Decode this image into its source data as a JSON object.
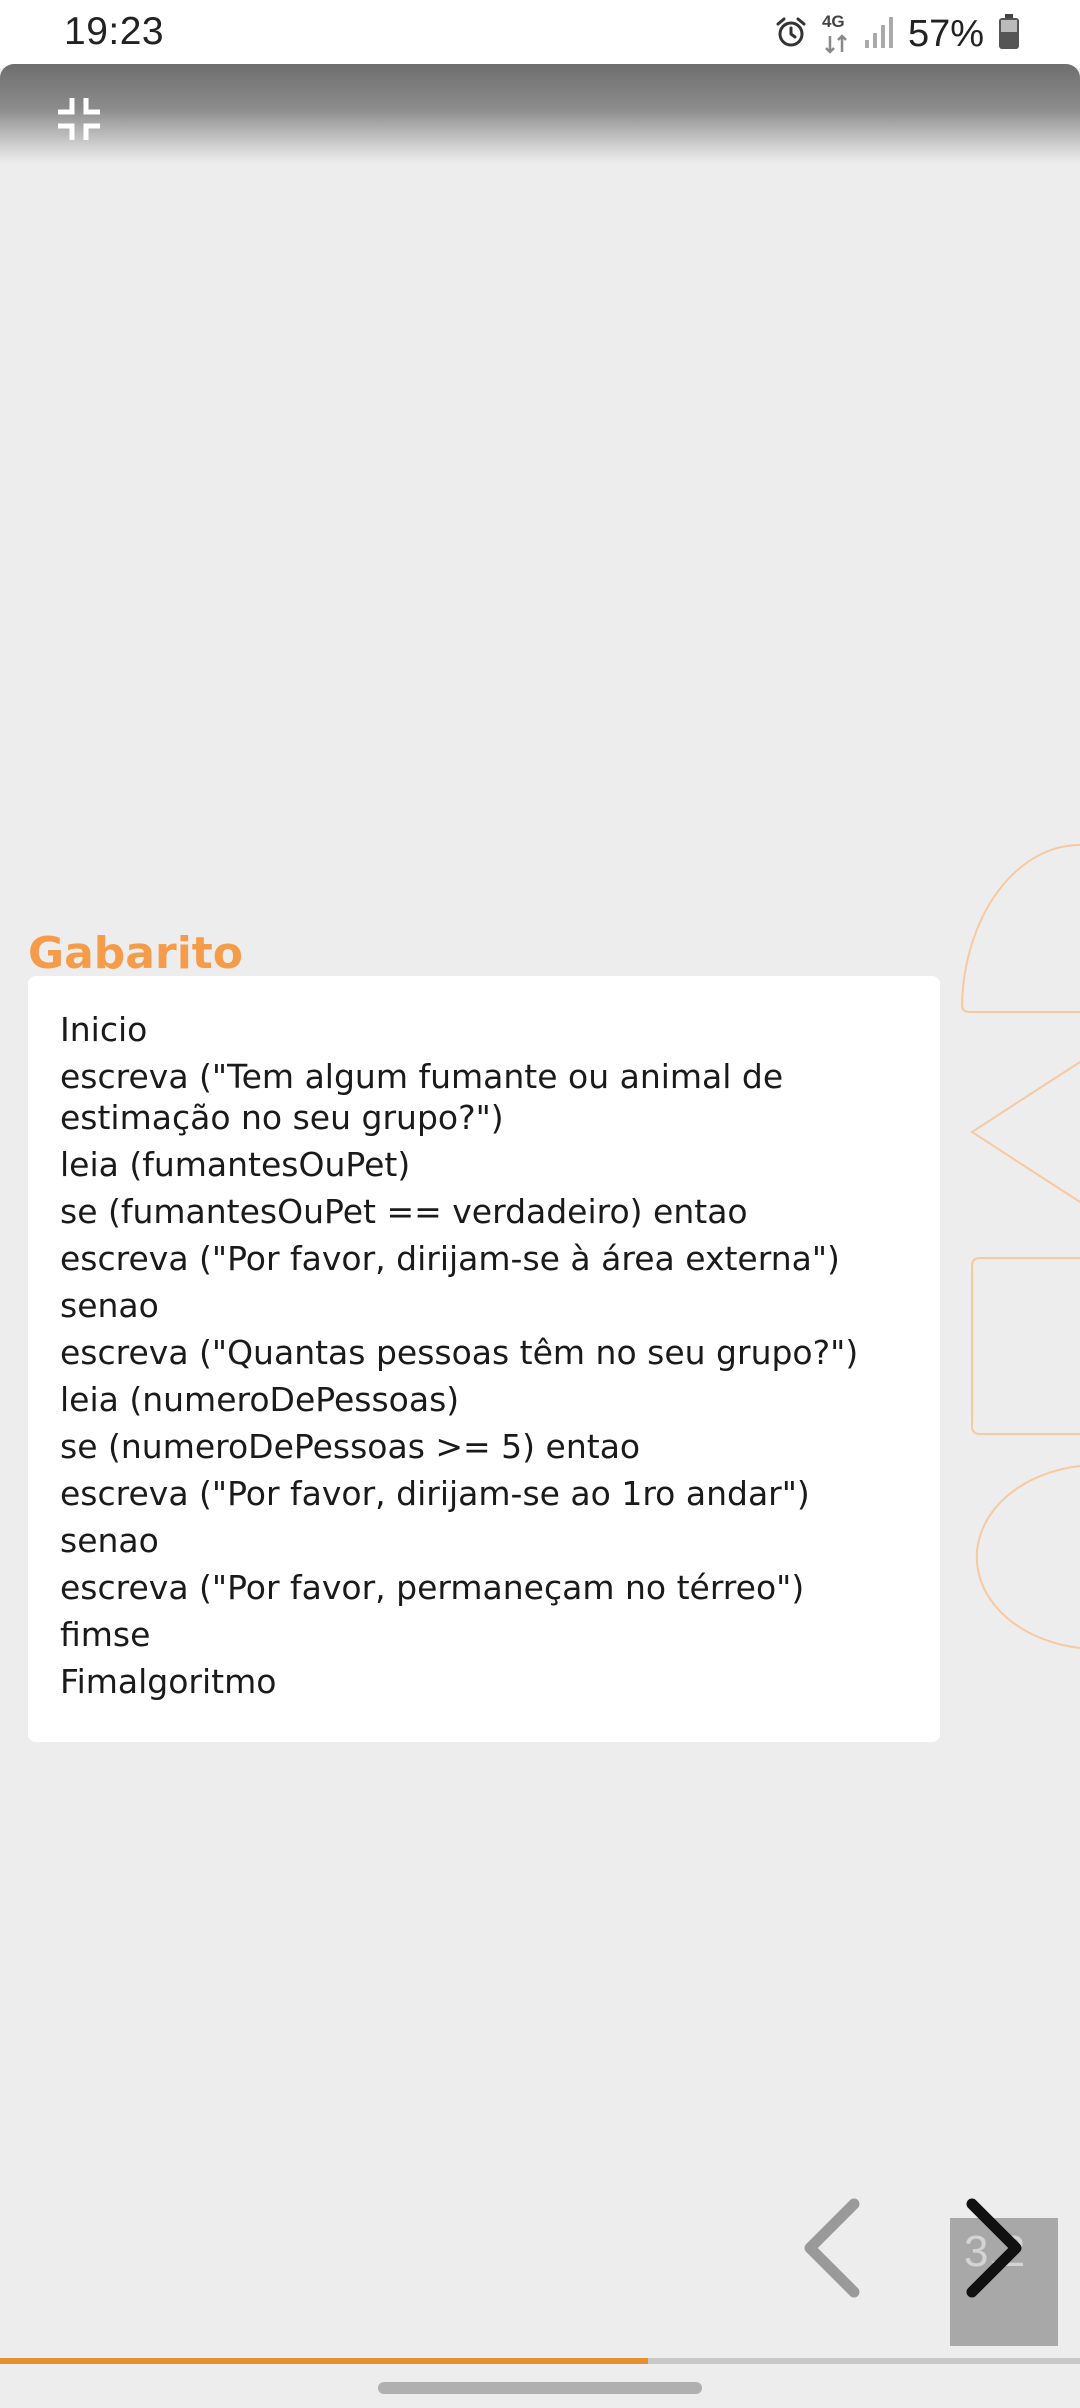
{
  "status_bar": {
    "time": "19:23",
    "network": "4G",
    "battery_percent": "57%",
    "icons": [
      "alarm-icon",
      "network-4g-icon",
      "signal-icon",
      "battery-icon"
    ]
  },
  "toolbar": {
    "icon": "exit-fullscreen-icon"
  },
  "content": {
    "title": "Gabarito",
    "lines": [
      "Inicio",
      "escreva (\"Tem algum fumante ou animal de estimação no seu grupo?\")",
      "leia (fumantesOuPet)",
      "se (fumantesOuPet == verdadeiro) entao",
      "escreva (\"Por favor, dirijam-se à área externa\")",
      "senao",
      "escreva (\"Quantas pessoas têm no seu grupo?\")",
      "leia (numeroDePessoas)",
      "se (numeroDePessoas >= 5) entao",
      "escreva (\"Por favor, dirijam-se ao 1ro andar\")",
      "senao",
      "escreva (\"Por favor, permaneçam no térreo\")",
      "fimse",
      "Fimalgoritmo"
    ]
  },
  "navigation": {
    "page_indicator": "3.2",
    "prev_icon": "chevron-left-icon",
    "next_icon": "chevron-right-icon"
  },
  "progress": {
    "fraction": 0.6
  },
  "colors": {
    "accent": "#f59c4a",
    "progress": "#e8902e",
    "background": "#ededed"
  }
}
